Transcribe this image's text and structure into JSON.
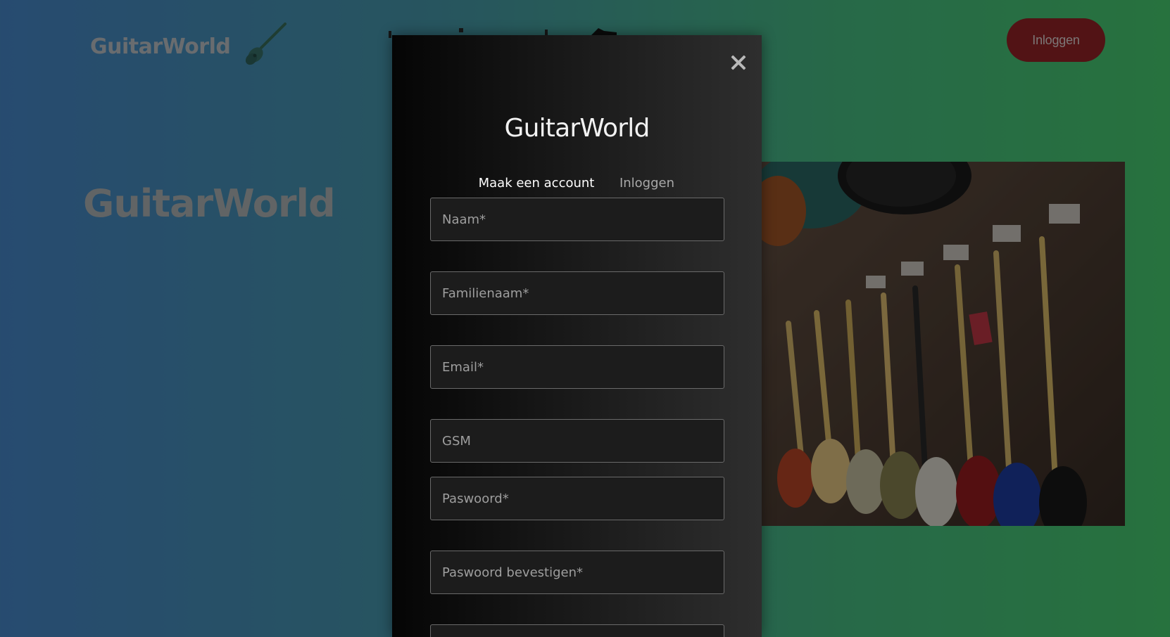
{
  "header": {
    "logo_text": "GuitarWorld",
    "login_button": "Inloggen"
  },
  "hero": {
    "title": "GuitarWorld"
  },
  "modal": {
    "title": "GuitarWorld",
    "tabs": [
      {
        "label": "Maak een account",
        "active": true
      },
      {
        "label": "Inloggen",
        "active": false
      }
    ],
    "fields": [
      {
        "placeholder": "Naam*",
        "value": ""
      },
      {
        "placeholder": "Familienaam*",
        "value": ""
      },
      {
        "placeholder": "Email*",
        "value": ""
      },
      {
        "placeholder": "GSM",
        "value": ""
      },
      {
        "placeholder": "Paswoord*",
        "value": ""
      },
      {
        "placeholder": "Paswoord bevestigen*",
        "value": ""
      }
    ]
  },
  "colors": {
    "accent_red": "#c8262b",
    "login_button_bg": "#7a1c1f",
    "modal_bg": "#161616"
  },
  "icons": {
    "logo": "guitar-icon",
    "close": "close-icon"
  }
}
